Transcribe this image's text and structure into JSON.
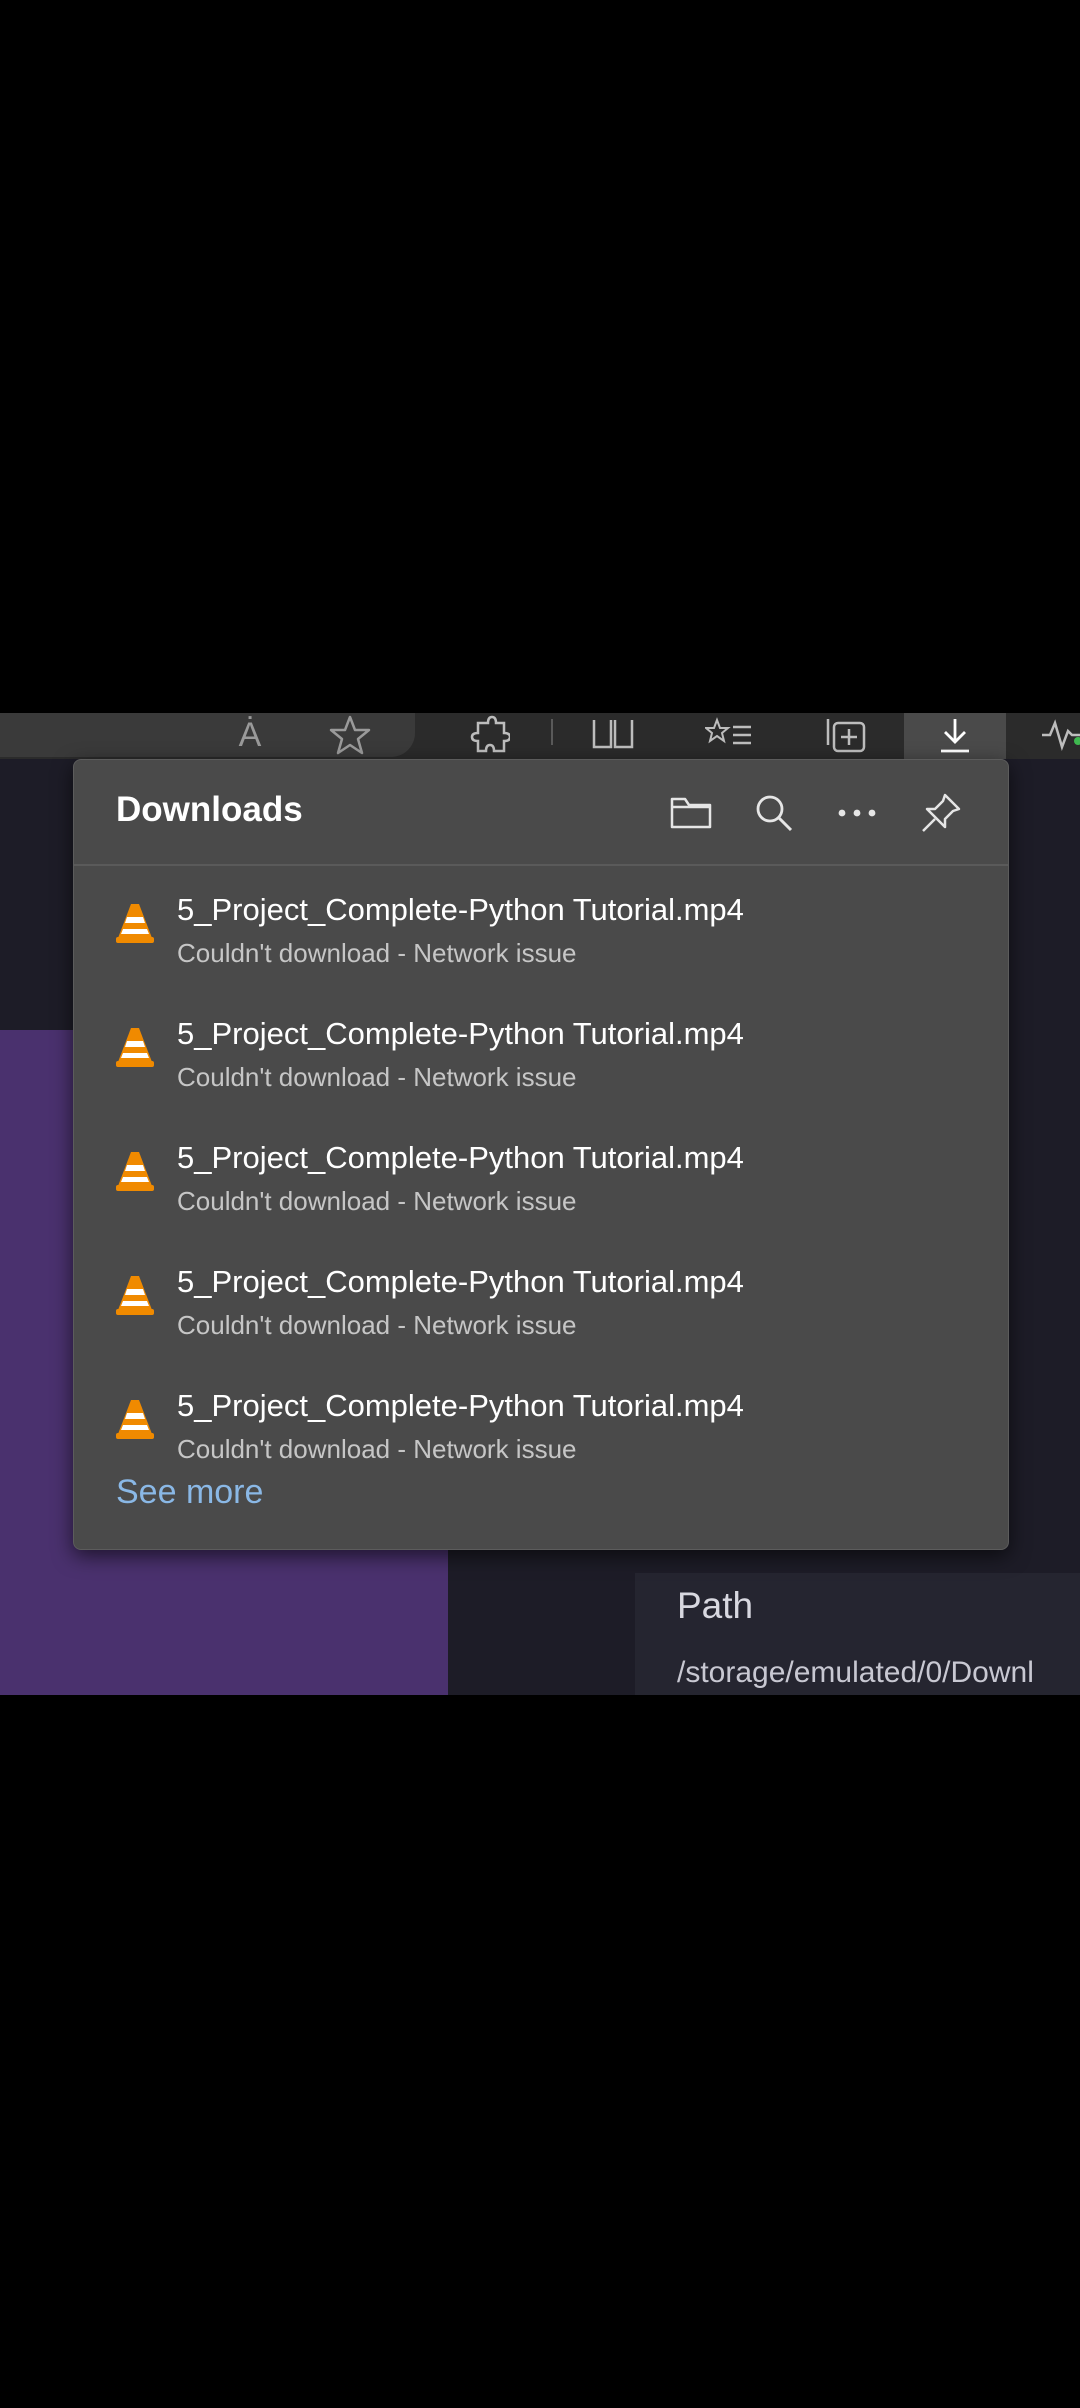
{
  "toolbar": {
    "icons": [
      "read-aloud-icon",
      "favorite-star-icon",
      "extensions-icon",
      "split-screen-icon",
      "favorites-list-icon",
      "collections-icon",
      "downloads-icon",
      "performance-icon"
    ],
    "read_aloud_label": "Ȧ",
    "separator": "|"
  },
  "downloads": {
    "title": "Downloads",
    "header_actions": [
      "open-folder-icon",
      "search-icon",
      "more-options-icon",
      "pin-icon"
    ],
    "items": [
      {
        "filename": "5_Project_Complete-Python Tutorial.mp4",
        "status": "Couldn't download - Network issue",
        "icon": "vlc-cone-icon"
      },
      {
        "filename": "5_Project_Complete-Python Tutorial.mp4",
        "status": "Couldn't download - Network issue",
        "icon": "vlc-cone-icon"
      },
      {
        "filename": "5_Project_Complete-Python Tutorial.mp4",
        "status": "Couldn't download - Network issue",
        "icon": "vlc-cone-icon"
      },
      {
        "filename": "5_Project_Complete-Python Tutorial.mp4",
        "status": "Couldn't download - Network issue",
        "icon": "vlc-cone-icon"
      },
      {
        "filename": "5_Project_Complete-Python Tutorial.mp4",
        "status": "Couldn't download - Network issue",
        "icon": "vlc-cone-icon"
      }
    ],
    "see_more": "See more"
  },
  "background": {
    "path_label": "Path",
    "path_value": "/storage/emulated/0/Downl"
  },
  "colors": {
    "flyout_bg": "#4a4a4a",
    "link": "#8ab8e6",
    "purple": "#4a316e"
  }
}
